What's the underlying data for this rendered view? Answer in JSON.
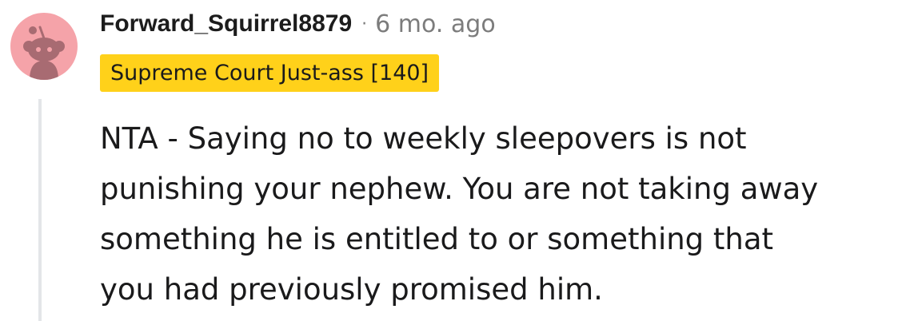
{
  "comment": {
    "author": "Forward_Squirrel8879",
    "separator": "·",
    "timestamp": "6 mo. ago",
    "flair": "Supreme Court Just-ass [140]",
    "body_lines": [
      "NTA - Saying no to weekly sleepovers is not",
      "punishing your nephew. You are not taking away",
      "something he is entitled to or something that",
      "you had previously promised him."
    ]
  },
  "colors": {
    "avatar_bg": "#f5a3a9",
    "flair_bg": "#ffd11a",
    "thread_line": "#e3e5e8",
    "meta_gray": "#7c7c7c"
  },
  "icons": {
    "avatar": "snoo-avatar-icon"
  }
}
